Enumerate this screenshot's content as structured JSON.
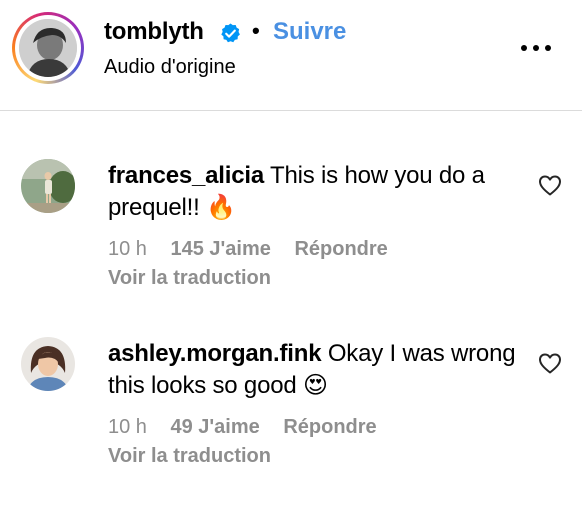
{
  "header": {
    "username": "tomblyth",
    "separator": "•",
    "follow_label": "Suivre",
    "subtitle": "Audio d'origine",
    "verified_icon": "verified-badge-icon",
    "more_icon": "more-options-icon",
    "ring_colors": [
      "#feda75",
      "#fa7e1e",
      "#d62976",
      "#962fbf",
      "#4f5bd5"
    ]
  },
  "comments": [
    {
      "username": "frances_alicia",
      "text": "This is how you do a prequel!! 🔥",
      "time": "10 h",
      "likes": "145 J'aime",
      "reply_label": "Répondre",
      "translate_label": "Voir la traduction"
    },
    {
      "username": "ashley.morgan.fink",
      "text": "Okay I was wrong this looks so good 😍",
      "time": "10 h",
      "likes": "49 J'aime",
      "reply_label": "Répondre",
      "translate_label": "Voir la traduction"
    }
  ],
  "colors": {
    "link_blue": "#4a90e2",
    "meta_gray": "#8e8e8e",
    "divider": "#dbdbdb"
  }
}
